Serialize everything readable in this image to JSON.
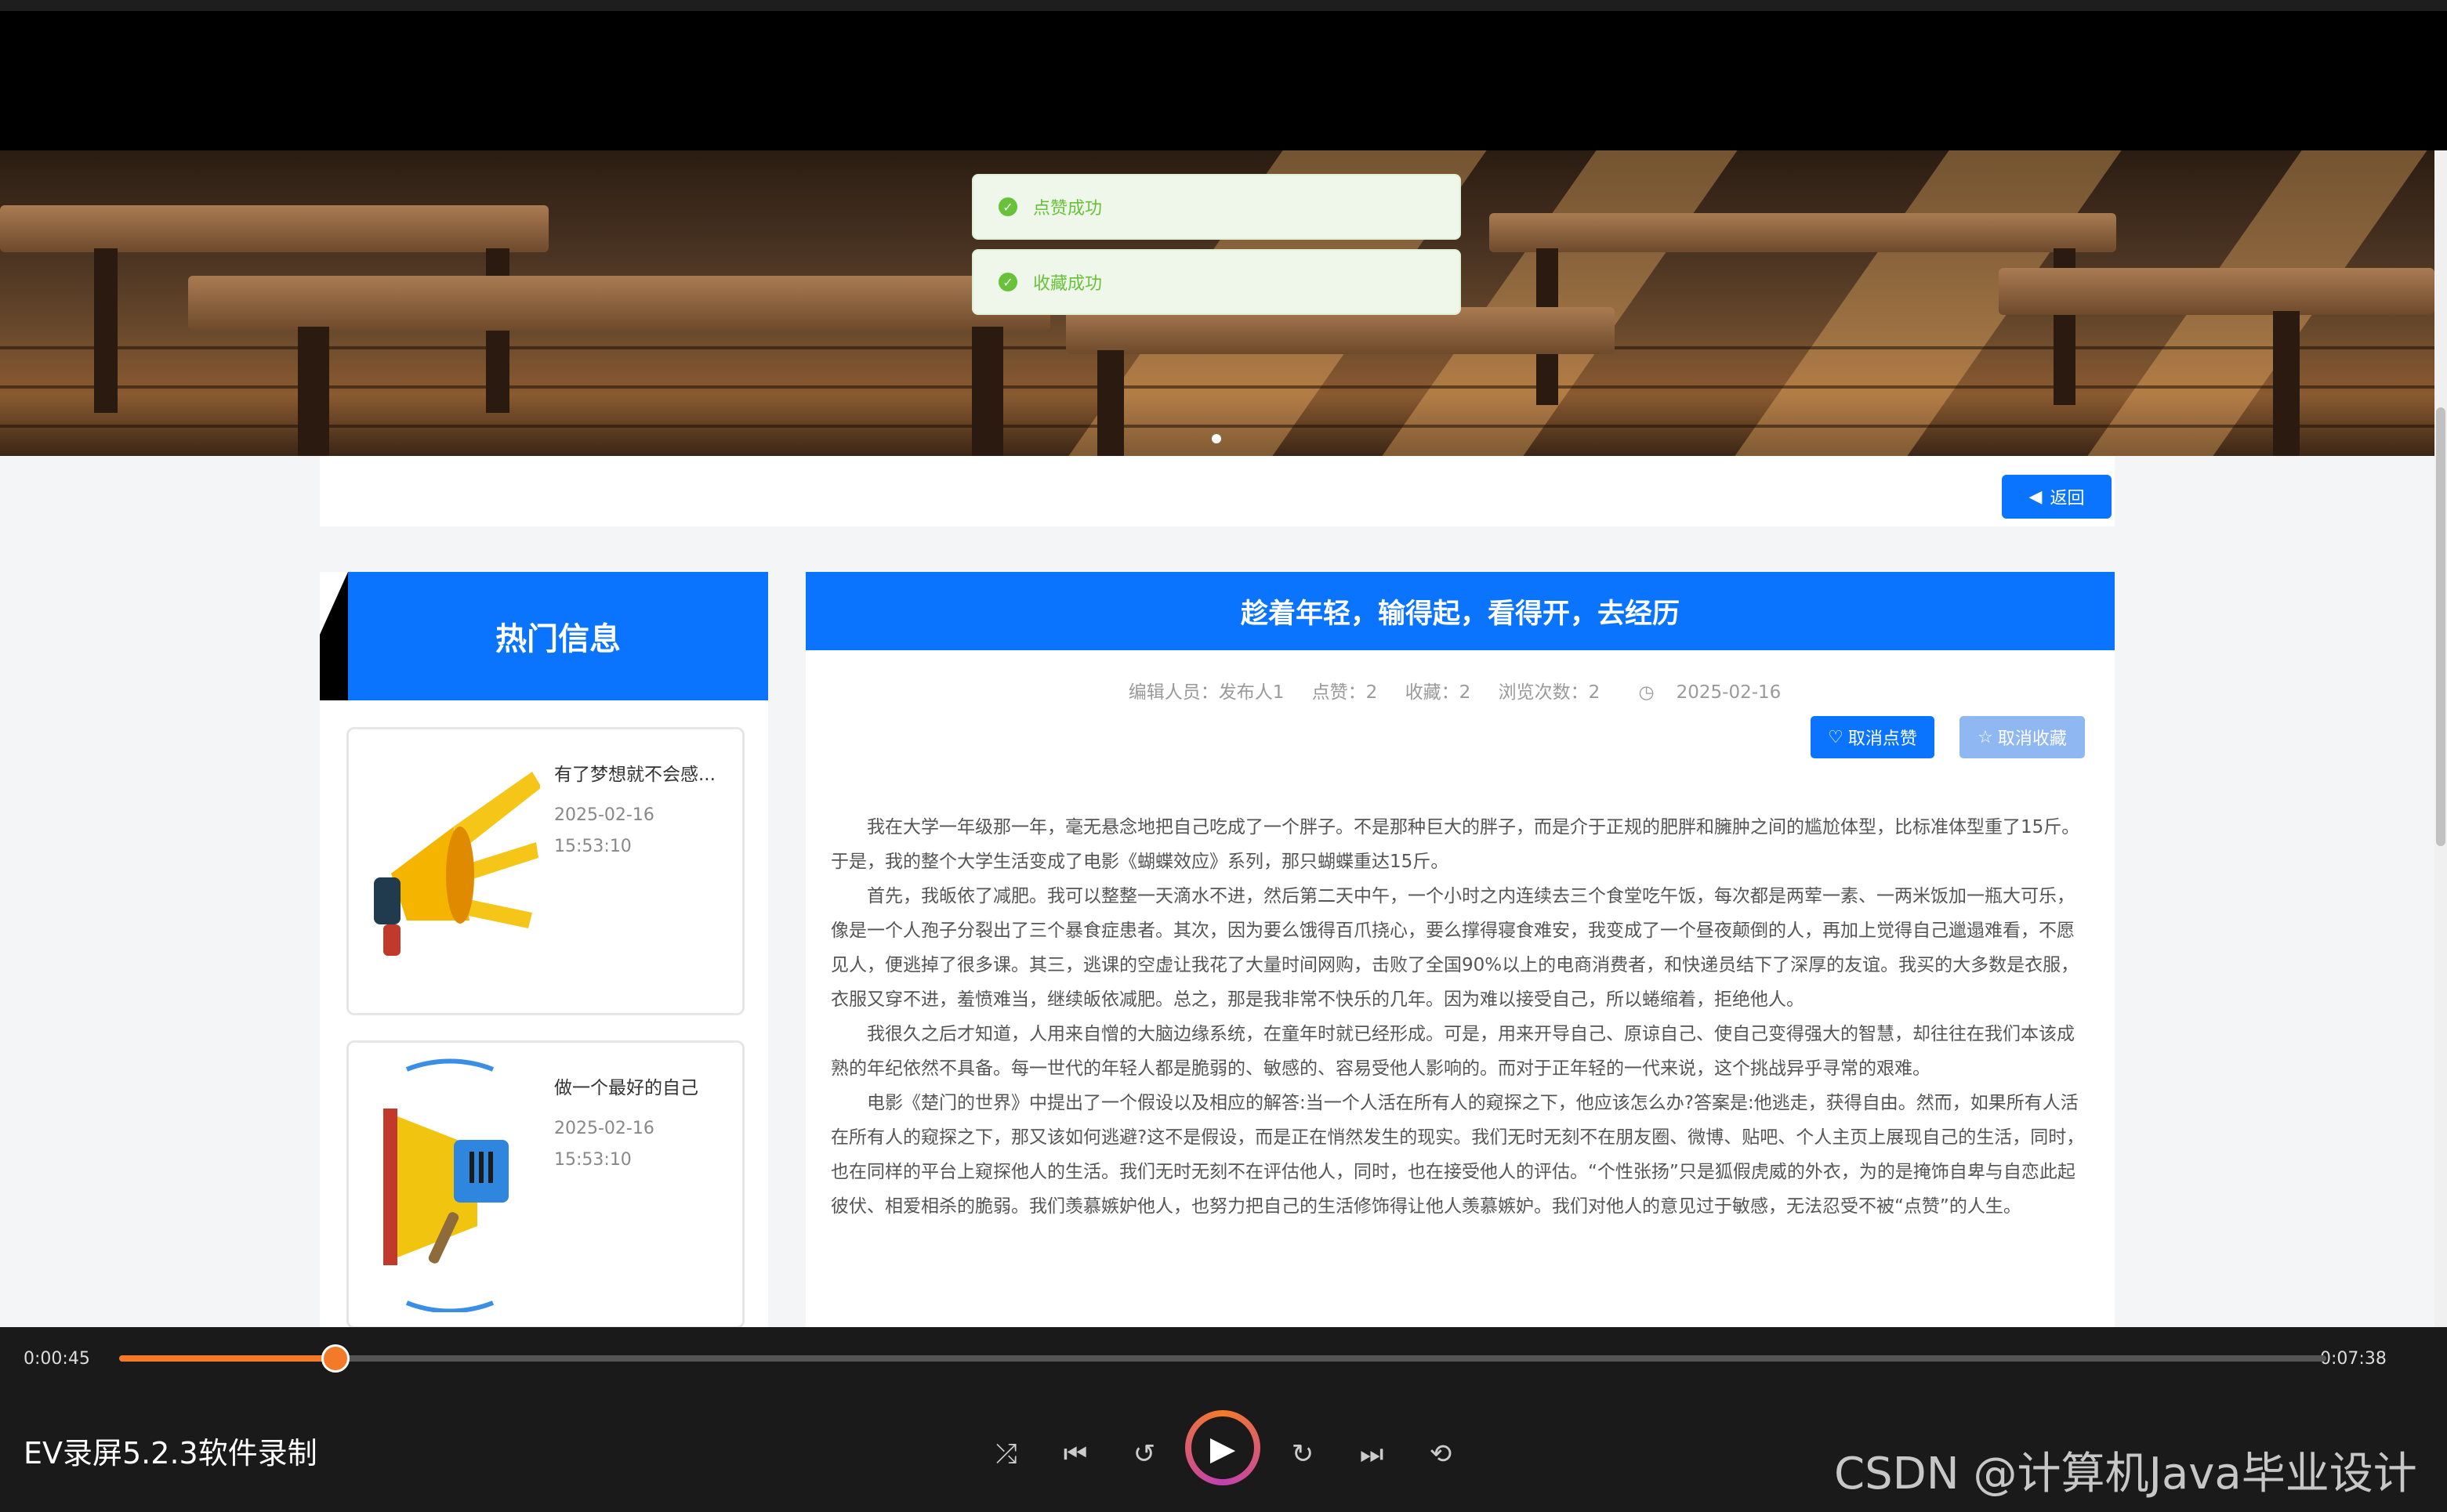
{
  "toasts": [
    "点赞成功",
    "收藏成功"
  ],
  "nav": {
    "back_label": "返回"
  },
  "sidebar": {
    "heading": "热门信息",
    "items": [
      {
        "title": "有了梦想就不会感...",
        "date": "2025-02-16",
        "time": "15:53:10",
        "icon": "megaphone-yellow-icon"
      },
      {
        "title": "做一个最好的自己",
        "date": "2025-02-16",
        "time": "15:53:10",
        "icon": "megaphone-blue-icon"
      }
    ]
  },
  "article": {
    "title": "趁着年轻，输得起，看得开，去经历",
    "meta": {
      "editor": "编辑人员：发布人1",
      "likes": "点赞：2",
      "favorites": "收藏：2",
      "views": "浏览次数：2",
      "date": "2025-02-16"
    },
    "unlike_label": "取消点赞",
    "unfavorite_label": "取消收藏",
    "paragraphs": [
      "我在大学一年级那一年，毫无悬念地把自己吃成了一个胖子。不是那种巨大的胖子，而是介于正规的肥胖和臃肿之间的尴尬体型，比标准体型重了15斤。于是，我的整个大学生活变成了电影《蝴蝶效应》系列，那只蝴蝶重达15斤。",
      "首先，我皈依了减肥。我可以整整一天滴水不进，然后第二天中午，一个小时之内连续去三个食堂吃午饭，每次都是两荤一素、一两米饭加一瓶大可乐，像是一个人孢子分裂出了三个暴食症患者。其次，因为要么饿得百爪挠心，要么撑得寝食难安，我变成了一个昼夜颠倒的人，再加上觉得自己邋遢难看，不愿见人，便逃掉了很多课。其三，逃课的空虚让我花了大量时间网购，击败了全国90%以上的电商消费者，和快递员结下了深厚的友谊。我买的大多数是衣服，衣服又穿不进，羞愤难当，继续皈依减肥。总之，那是我非常不快乐的几年。因为难以接受自己，所以蜷缩着，拒绝他人。",
      "我很久之后才知道，人用来自憎的大脑边缘系统，在童年时就已经形成。可是，用来开导自己、原谅自己、使自己变得强大的智慧，却往往在我们本该成熟的年纪依然不具备。每一世代的年轻人都是脆弱的、敏感的、容易受他人影响的。而对于正年轻的一代来说，这个挑战异乎寻常的艰难。",
      "电影《楚门的世界》中提出了一个假设以及相应的解答:当一个人活在所有人的窥探之下，他应该怎么办?答案是:他逃走，获得自由。然而，如果所有人活在所有人的窥探之下，那又该如何逃避?这不是假设，而是正在悄然发生的现实。我们无时无刻不在朋友圈、微博、贴吧、个人主页上展现自己的生活，同时，也在同样的平台上窥探他人的生活。我们无时无刻不在评估他人，同时，也在接受他人的评估。“个性张扬”只是狐假虎威的外衣，为的是掩饰自卑与自恋此起彼伏、相爱相杀的脆弱。我们羡慕嫉妒他人，也努力把自己的生活修饰得让他人羡慕嫉妒。我们对他人的意见过于敏感，无法忍受不被“点赞”的人生。"
    ]
  },
  "player": {
    "current_time": "0:00:45",
    "total_time": "0:07:38",
    "progress": 0.098,
    "app_label": "EV录屏5.2.3软件录制",
    "accent": "#f47a2a"
  },
  "watermark": "CSDN @计算机Java毕业设计",
  "colors": {
    "primary": "#0b74ff",
    "success": "#67c23a"
  }
}
